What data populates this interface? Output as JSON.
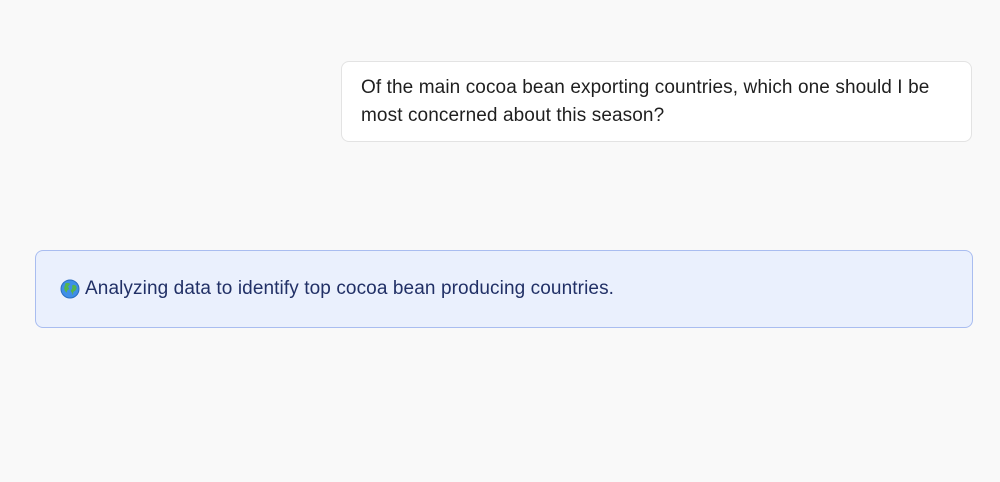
{
  "conversation": {
    "user_message": "Of the main cocoa bean exporting countries, which one should I be most concerned about this season?",
    "status": {
      "icon": "globe-icon",
      "text": "Analyzing data to identify top cocoa bean producing countries."
    }
  },
  "colors": {
    "background": "#f9f9f9",
    "user_bubble": "#ffffff",
    "status_bubble": "#eaf0fd",
    "status_border": "#a9bdf0",
    "status_text": "#213066"
  }
}
